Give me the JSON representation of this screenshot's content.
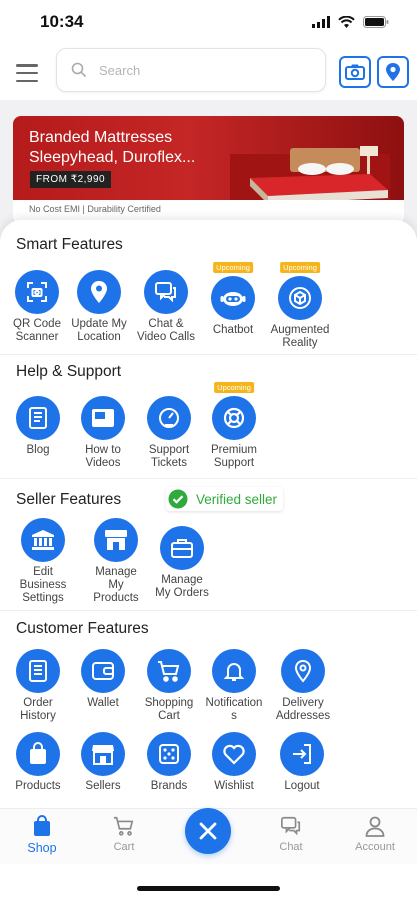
{
  "status": {
    "time": "10:34"
  },
  "search": {
    "placeholder": "Search"
  },
  "banner": {
    "title_line1": "Branded Mattresses",
    "title_line2": "Sleepyhead, Duroflex...",
    "price": "FROM ₹2,990",
    "footer": "No Cost EMI | Durability Certified"
  },
  "sections": {
    "smart": {
      "title": "Smart Features",
      "items": [
        {
          "line1": "QR Code",
          "line2": "Scanner",
          "icon": "qr-scan-icon"
        },
        {
          "line1": "Update My",
          "line2": "Location",
          "icon": "location-pin-icon"
        },
        {
          "line1": "Chat &",
          "line2": "Video Calls",
          "icon": "chat-icon"
        },
        {
          "line1": "Chatbot",
          "line2": "",
          "icon": "robot-icon",
          "badge": "Upcoming"
        },
        {
          "line1": "Augmented",
          "line2": "Reality",
          "icon": "cube-icon",
          "badge": "Upcoming"
        }
      ]
    },
    "help": {
      "title": "Help & Support",
      "items": [
        {
          "line1": "Blog",
          "line2": "",
          "icon": "blog-icon"
        },
        {
          "line1": "How to",
          "line2": "Videos",
          "icon": "video-icon"
        },
        {
          "line1": "Support",
          "line2": "Tickets",
          "icon": "gauge-icon"
        },
        {
          "line1": "Premium",
          "line2": "Support",
          "icon": "lifebuoy-icon",
          "badge": "Upcoming"
        }
      ]
    },
    "seller": {
      "title": "Seller Features",
      "verified": "Verified seller",
      "items": [
        {
          "line1": "Edit",
          "line2": "Business",
          "line3": "Settings",
          "icon": "bank-icon"
        },
        {
          "line1": "Manage",
          "line2": "My",
          "line3": "Products",
          "icon": "store-icon"
        },
        {
          "line1": "Manage",
          "line2": "My Orders",
          "line3": "",
          "icon": "briefcase-icon"
        }
      ]
    },
    "customer": {
      "title": "Customer Features",
      "items": [
        {
          "line1": "Order",
          "line2": "History",
          "icon": "order-history-icon"
        },
        {
          "line1": "Wallet",
          "line2": "",
          "icon": "wallet-icon"
        },
        {
          "line1": "Shopping",
          "line2": "Cart",
          "icon": "cart-icon"
        },
        {
          "line1": "Notification",
          "line2": "s",
          "icon": "bell-icon"
        },
        {
          "line1": "Delivery",
          "line2": "Addresses",
          "icon": "location-pin-icon"
        },
        {
          "line1": "Products",
          "line2": "",
          "icon": "bag-icon"
        },
        {
          "line1": "Sellers",
          "line2": "",
          "icon": "shop-icon"
        },
        {
          "line1": "Brands",
          "line2": "",
          "icon": "dice-icon"
        },
        {
          "line1": "Wishlist",
          "line2": "",
          "icon": "heart-icon"
        },
        {
          "line1": "Logout",
          "line2": "",
          "icon": "logout-icon"
        }
      ]
    }
  },
  "nav": {
    "shop": "Shop",
    "cart": "Cart",
    "chat": "Chat",
    "account": "Account"
  },
  "colors": {
    "accent": "#1e73e8",
    "badge": "#f5b51a",
    "verified": "#2eab3c"
  }
}
